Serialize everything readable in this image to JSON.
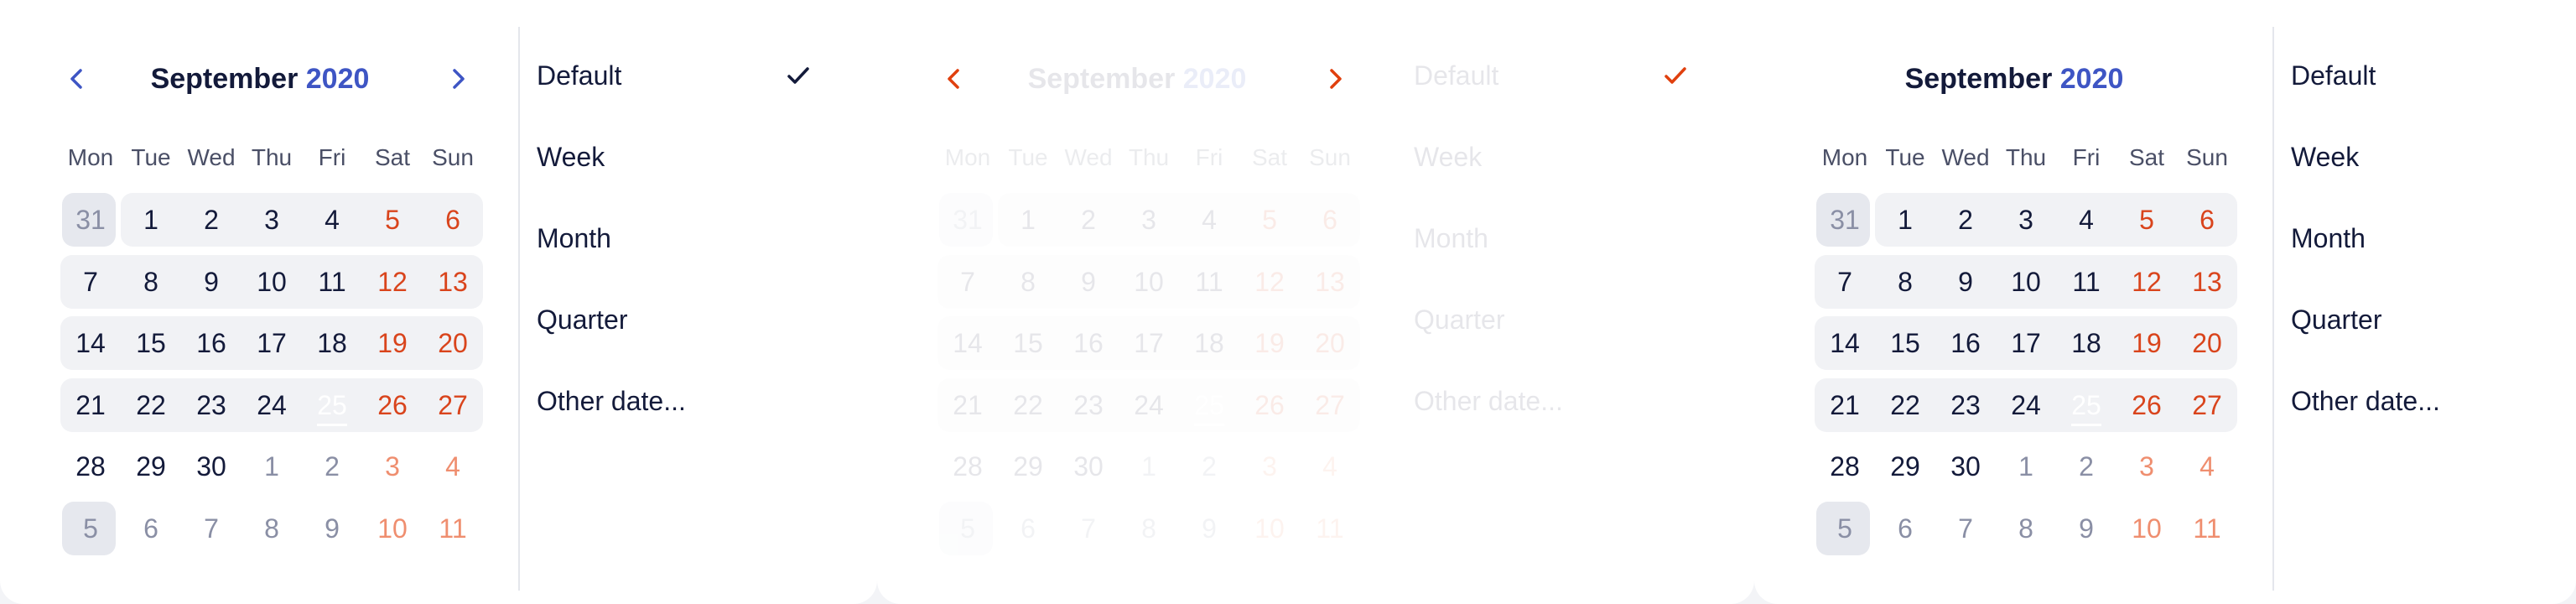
{
  "calendar": {
    "month": "September",
    "year": "2020",
    "weekdays": [
      "Mon",
      "Tue",
      "Wed",
      "Thu",
      "Fri",
      "Sat",
      "Sun"
    ],
    "weeks": [
      [
        "31",
        "1",
        "2",
        "3",
        "4",
        "5",
        "6"
      ],
      [
        "7",
        "8",
        "9",
        "10",
        "11",
        "12",
        "13"
      ],
      [
        "14",
        "15",
        "16",
        "17",
        "18",
        "19",
        "20"
      ],
      [
        "21",
        "22",
        "23",
        "24",
        "25",
        "26",
        "27"
      ],
      [
        "28",
        "29",
        "30",
        "1",
        "2",
        "3",
        "4"
      ],
      [
        "5",
        "6",
        "7",
        "8",
        "9",
        "10",
        "11"
      ]
    ],
    "selected_day": "25"
  },
  "menu": {
    "items": [
      "Default",
      "Week",
      "Month",
      "Quarter",
      "Other date..."
    ],
    "checked": "Default"
  },
  "colors": {
    "accent": "#3e55c4",
    "selected_fill": "#4f67d3",
    "weekend": "#d9441c",
    "nav_arrow_default": "#3e55c4",
    "nav_arrow_active": "#e0400e",
    "check_active": "#e0400e",
    "text": "#131a3a"
  },
  "icons": {
    "prev": "chevron-left-icon",
    "next": "chevron-right-icon",
    "check": "checkmark-icon"
  }
}
